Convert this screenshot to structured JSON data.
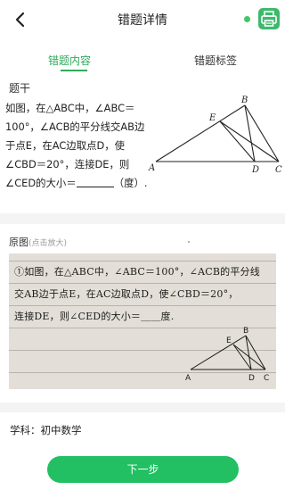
{
  "header": {
    "title": "错题详情"
  },
  "tabs": [
    {
      "label": "错题内容"
    },
    {
      "label": "错题标签"
    }
  ],
  "question": {
    "section_label": "题干",
    "text_part1": "如图，在△ABC中，∠ABC＝100°，∠ACB的平分线交AB边于点E，在AC边取点D，使∠CBD＝20°，连接DE，则∠CED的大小＝",
    "text_part2": "（度）."
  },
  "diagram": {
    "points": [
      "A",
      "B",
      "C",
      "D",
      "E"
    ]
  },
  "original": {
    "label": "原图",
    "hint": "(点击放大)",
    "handwriting_lines": [
      "①如图，在△ABC中，∠ABC＝100°，∠ACB的平分线",
      "交AB边于点E，在AC边取点D，使∠CBD＝20°，",
      "连接DE，则∠CED的大小＝＿＿度."
    ],
    "photo_points": [
      "A",
      "B",
      "C",
      "D",
      "E"
    ]
  },
  "subject": {
    "text": "学科：初中数学"
  },
  "actions": {
    "next_label": "下一步"
  }
}
